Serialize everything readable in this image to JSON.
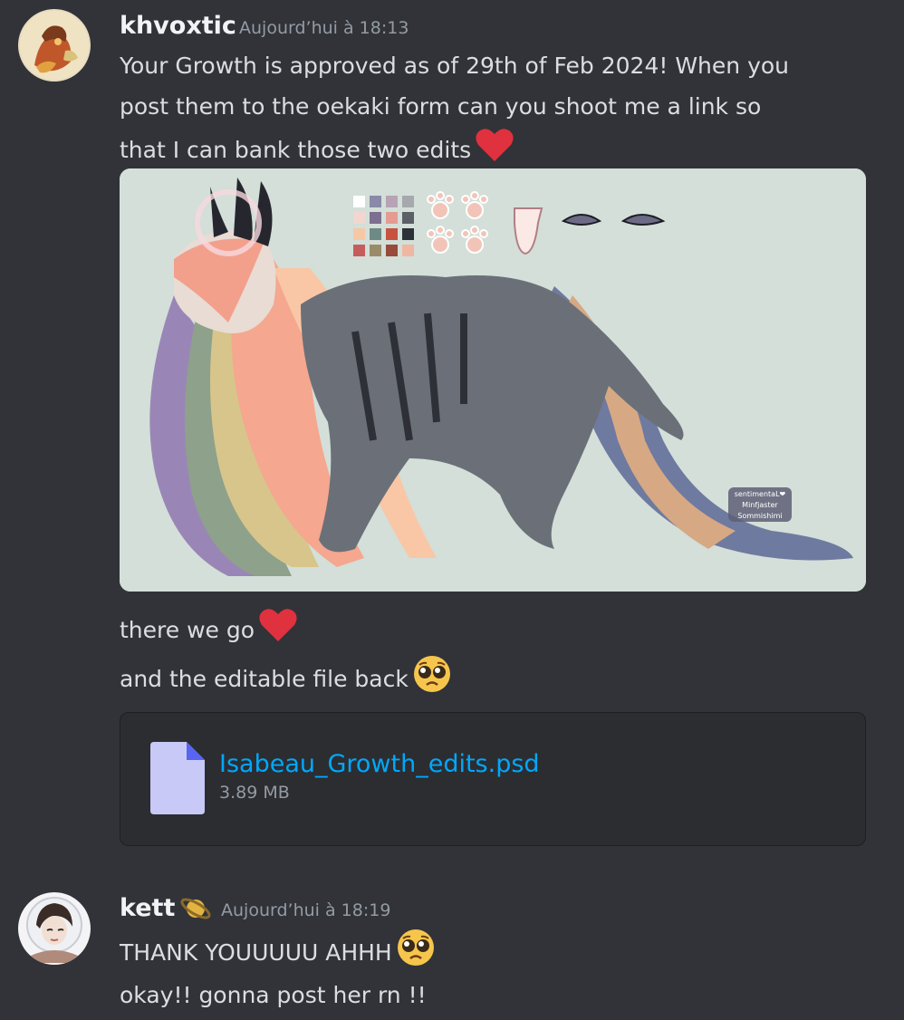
{
  "messages": [
    {
      "username": "khvoxtic",
      "timestamp": "Aujourd’hui à 18:13",
      "lines": [
        "Your Growth is approved as of 29th of Feb 2024! When you",
        "post them to the oekaki form can you shoot me a link so",
        "that I can bank those two edits"
      ],
      "image": {
        "watermark_lines": [
          "sentimentaL❤",
          "Minfjaster",
          "Sommishimi"
        ]
      },
      "after_lines": [
        "there we go",
        "and the editable file back"
      ],
      "attachment": {
        "name": "Isabeau_Growth_edits.psd",
        "size": "3.89 MB"
      }
    },
    {
      "username": "kett",
      "timestamp": "Aujourd’hui à 18:19",
      "lines": [
        "THANK YOUUUUU AHHH",
        "okay!! gonna post her rn !!"
      ]
    }
  ],
  "icons": {
    "heart": "red-heart-emoji",
    "pleading": "pleading-face-emoji",
    "file": "file-icon",
    "planet": "ringed-planet-icon"
  },
  "colors": {
    "background": "#313338",
    "link": "#00a8fc",
    "heart": "#e0313f",
    "username": "#f2f3f5",
    "muted": "#949ba4"
  }
}
